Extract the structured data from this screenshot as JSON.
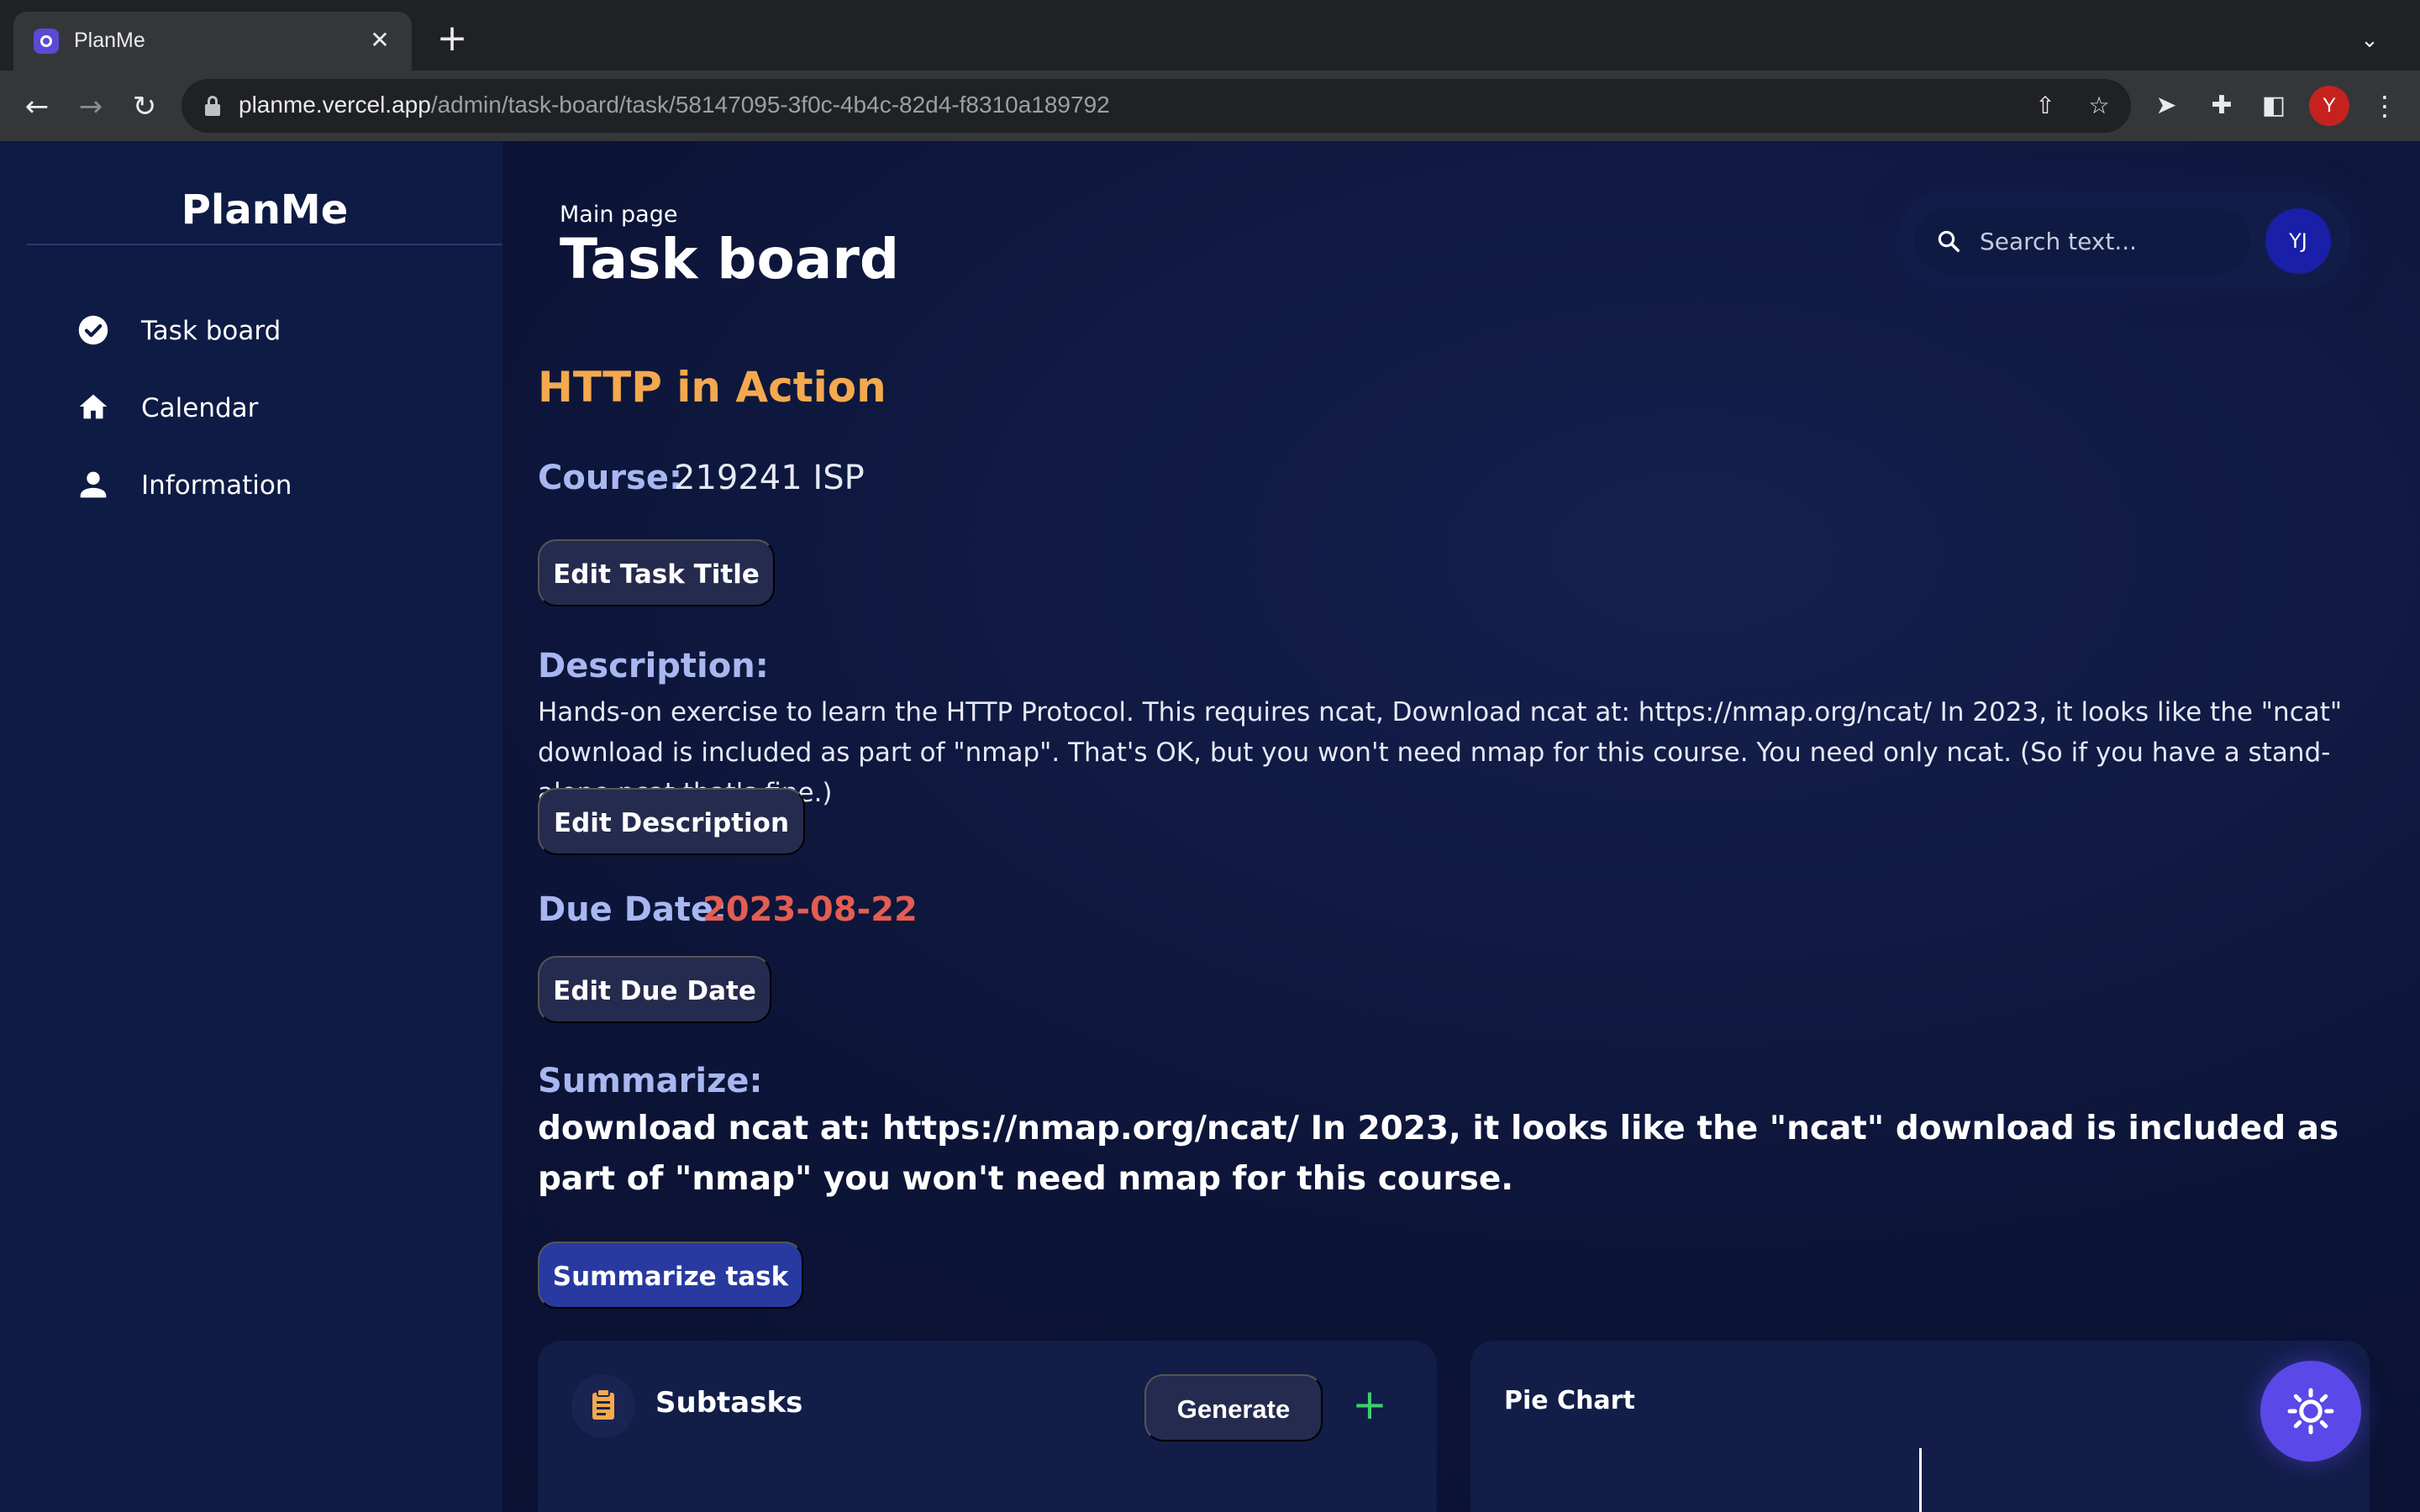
{
  "browser": {
    "tab_title": "PlanMe",
    "tab_close": "✕",
    "new_tab": "+",
    "url_host": "planme.vercel.app",
    "url_path": "/admin/task-board/task/58147095-3f0c-4b4c-82d4-f8310a189792",
    "profile_initial": "Y"
  },
  "sidebar": {
    "brand": "PlanMe",
    "items": [
      {
        "label": "Task board",
        "icon": "check-circle-icon"
      },
      {
        "label": "Calendar",
        "icon": "home-icon"
      },
      {
        "label": "Information",
        "icon": "person-icon"
      }
    ]
  },
  "header": {
    "breadcrumb": "Main page",
    "title": "Task board",
    "search_placeholder": "Search text...",
    "avatar_initials": "YJ"
  },
  "task": {
    "title": "HTTP in Action",
    "course_label": "Course:",
    "course_value": "219241 ISP",
    "edit_title_button": "Edit Task Title",
    "description_label": "Description:",
    "description": "Hands-on exercise to learn the HTTP Protocol. This requires ncat,  Download ncat at: https://nmap.org/ncat/ In 2023, it looks like the \"ncat\" download is included as part of \"nmap\". That's OK, but you won't need nmap for this course. You need only ncat. (So if you have a stand-alone ncat that's fine.)",
    "edit_description_button": "Edit Description",
    "due_label": "Due Date:",
    "due_value": "2023-08-22",
    "edit_due_button": "Edit Due Date",
    "summarize_label": "Summarize:",
    "summary": "download ncat at: https://nmap.org/ncat/ In 2023, it looks like the \"ncat\" download is included as part of \"nmap\" you won't need nmap for this course.",
    "summarize_button": "Summarize task"
  },
  "subtasks_card": {
    "title": "Subtasks",
    "generate_button": "Generate",
    "add_button": "+"
  },
  "pie_card": {
    "title": "Pie Chart"
  },
  "colors": {
    "task_title": "#f4a94e",
    "field_label": "#a8b7f0",
    "due_date": "#e35d52",
    "primary_button": "#283aa0",
    "theme_fab": "#5b48e8"
  }
}
